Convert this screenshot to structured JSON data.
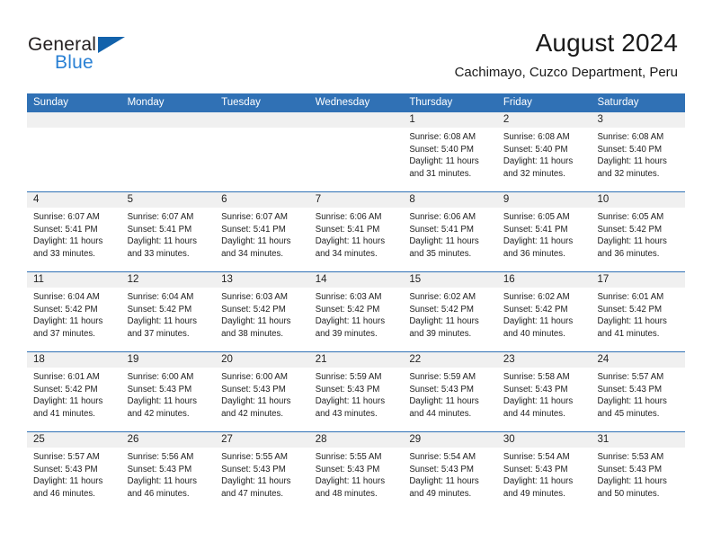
{
  "brand": {
    "name_top": "General",
    "name_bottom": "Blue",
    "triangle_color": "#1262ab",
    "blue_text_color": "#2980d4",
    "dark_text_color": "#231f20"
  },
  "header": {
    "title": "August 2024",
    "subtitle": "Cachimayo, Cuzco Department, Peru"
  },
  "theme": {
    "header_blue": "#3071b5",
    "daynum_band": "#f0f0f0",
    "text": "#1d1d1d"
  },
  "weekdays": [
    "Sunday",
    "Monday",
    "Tuesday",
    "Wednesday",
    "Thursday",
    "Friday",
    "Saturday"
  ],
  "weeks": [
    [
      {
        "day": "",
        "lines": []
      },
      {
        "day": "",
        "lines": []
      },
      {
        "day": "",
        "lines": []
      },
      {
        "day": "",
        "lines": []
      },
      {
        "day": "1",
        "lines": [
          "Sunrise: 6:08 AM",
          "Sunset: 5:40 PM",
          "Daylight: 11 hours",
          "and 31 minutes."
        ]
      },
      {
        "day": "2",
        "lines": [
          "Sunrise: 6:08 AM",
          "Sunset: 5:40 PM",
          "Daylight: 11 hours",
          "and 32 minutes."
        ]
      },
      {
        "day": "3",
        "lines": [
          "Sunrise: 6:08 AM",
          "Sunset: 5:40 PM",
          "Daylight: 11 hours",
          "and 32 minutes."
        ]
      }
    ],
    [
      {
        "day": "4",
        "lines": [
          "Sunrise: 6:07 AM",
          "Sunset: 5:41 PM",
          "Daylight: 11 hours",
          "and 33 minutes."
        ]
      },
      {
        "day": "5",
        "lines": [
          "Sunrise: 6:07 AM",
          "Sunset: 5:41 PM",
          "Daylight: 11 hours",
          "and 33 minutes."
        ]
      },
      {
        "day": "6",
        "lines": [
          "Sunrise: 6:07 AM",
          "Sunset: 5:41 PM",
          "Daylight: 11 hours",
          "and 34 minutes."
        ]
      },
      {
        "day": "7",
        "lines": [
          "Sunrise: 6:06 AM",
          "Sunset: 5:41 PM",
          "Daylight: 11 hours",
          "and 34 minutes."
        ]
      },
      {
        "day": "8",
        "lines": [
          "Sunrise: 6:06 AM",
          "Sunset: 5:41 PM",
          "Daylight: 11 hours",
          "and 35 minutes."
        ]
      },
      {
        "day": "9",
        "lines": [
          "Sunrise: 6:05 AM",
          "Sunset: 5:41 PM",
          "Daylight: 11 hours",
          "and 36 minutes."
        ]
      },
      {
        "day": "10",
        "lines": [
          "Sunrise: 6:05 AM",
          "Sunset: 5:42 PM",
          "Daylight: 11 hours",
          "and 36 minutes."
        ]
      }
    ],
    [
      {
        "day": "11",
        "lines": [
          "Sunrise: 6:04 AM",
          "Sunset: 5:42 PM",
          "Daylight: 11 hours",
          "and 37 minutes."
        ]
      },
      {
        "day": "12",
        "lines": [
          "Sunrise: 6:04 AM",
          "Sunset: 5:42 PM",
          "Daylight: 11 hours",
          "and 37 minutes."
        ]
      },
      {
        "day": "13",
        "lines": [
          "Sunrise: 6:03 AM",
          "Sunset: 5:42 PM",
          "Daylight: 11 hours",
          "and 38 minutes."
        ]
      },
      {
        "day": "14",
        "lines": [
          "Sunrise: 6:03 AM",
          "Sunset: 5:42 PM",
          "Daylight: 11 hours",
          "and 39 minutes."
        ]
      },
      {
        "day": "15",
        "lines": [
          "Sunrise: 6:02 AM",
          "Sunset: 5:42 PM",
          "Daylight: 11 hours",
          "and 39 minutes."
        ]
      },
      {
        "day": "16",
        "lines": [
          "Sunrise: 6:02 AM",
          "Sunset: 5:42 PM",
          "Daylight: 11 hours",
          "and 40 minutes."
        ]
      },
      {
        "day": "17",
        "lines": [
          "Sunrise: 6:01 AM",
          "Sunset: 5:42 PM",
          "Daylight: 11 hours",
          "and 41 minutes."
        ]
      }
    ],
    [
      {
        "day": "18",
        "lines": [
          "Sunrise: 6:01 AM",
          "Sunset: 5:42 PM",
          "Daylight: 11 hours",
          "and 41 minutes."
        ]
      },
      {
        "day": "19",
        "lines": [
          "Sunrise: 6:00 AM",
          "Sunset: 5:43 PM",
          "Daylight: 11 hours",
          "and 42 minutes."
        ]
      },
      {
        "day": "20",
        "lines": [
          "Sunrise: 6:00 AM",
          "Sunset: 5:43 PM",
          "Daylight: 11 hours",
          "and 42 minutes."
        ]
      },
      {
        "day": "21",
        "lines": [
          "Sunrise: 5:59 AM",
          "Sunset: 5:43 PM",
          "Daylight: 11 hours",
          "and 43 minutes."
        ]
      },
      {
        "day": "22",
        "lines": [
          "Sunrise: 5:59 AM",
          "Sunset: 5:43 PM",
          "Daylight: 11 hours",
          "and 44 minutes."
        ]
      },
      {
        "day": "23",
        "lines": [
          "Sunrise: 5:58 AM",
          "Sunset: 5:43 PM",
          "Daylight: 11 hours",
          "and 44 minutes."
        ]
      },
      {
        "day": "24",
        "lines": [
          "Sunrise: 5:57 AM",
          "Sunset: 5:43 PM",
          "Daylight: 11 hours",
          "and 45 minutes."
        ]
      }
    ],
    [
      {
        "day": "25",
        "lines": [
          "Sunrise: 5:57 AM",
          "Sunset: 5:43 PM",
          "Daylight: 11 hours",
          "and 46 minutes."
        ]
      },
      {
        "day": "26",
        "lines": [
          "Sunrise: 5:56 AM",
          "Sunset: 5:43 PM",
          "Daylight: 11 hours",
          "and 46 minutes."
        ]
      },
      {
        "day": "27",
        "lines": [
          "Sunrise: 5:55 AM",
          "Sunset: 5:43 PM",
          "Daylight: 11 hours",
          "and 47 minutes."
        ]
      },
      {
        "day": "28",
        "lines": [
          "Sunrise: 5:55 AM",
          "Sunset: 5:43 PM",
          "Daylight: 11 hours",
          "and 48 minutes."
        ]
      },
      {
        "day": "29",
        "lines": [
          "Sunrise: 5:54 AM",
          "Sunset: 5:43 PM",
          "Daylight: 11 hours",
          "and 49 minutes."
        ]
      },
      {
        "day": "30",
        "lines": [
          "Sunrise: 5:54 AM",
          "Sunset: 5:43 PM",
          "Daylight: 11 hours",
          "and 49 minutes."
        ]
      },
      {
        "day": "31",
        "lines": [
          "Sunrise: 5:53 AM",
          "Sunset: 5:43 PM",
          "Daylight: 11 hours",
          "and 50 minutes."
        ]
      }
    ]
  ]
}
